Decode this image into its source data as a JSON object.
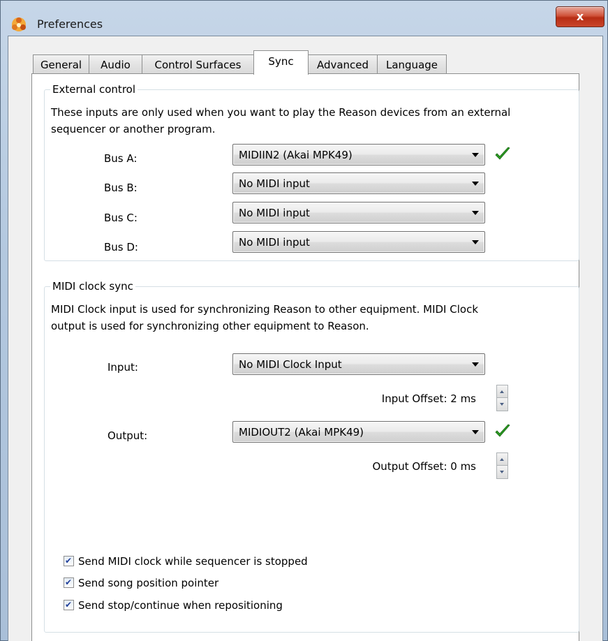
{
  "window": {
    "title": "Preferences",
    "close_label": "x"
  },
  "tabs": [
    {
      "label": "General"
    },
    {
      "label": "Audio"
    },
    {
      "label": "Control Surfaces"
    },
    {
      "label": "Sync"
    },
    {
      "label": "Advanced"
    },
    {
      "label": "Language"
    }
  ],
  "active_tab": "Sync",
  "external_control": {
    "legend": "External control",
    "desc_line1": "These inputs are only used when you want to play the Reason devices from an external",
    "desc_line2": "sequencer or another program.",
    "buses": [
      {
        "label": "Bus A:",
        "value": "MIDIIN2 (Akai MPK49)",
        "connected": true
      },
      {
        "label": "Bus B:",
        "value": "No MIDI input",
        "connected": false
      },
      {
        "label": "Bus C:",
        "value": "No MIDI input",
        "connected": false
      },
      {
        "label": "Bus D:",
        "value": "No MIDI input",
        "connected": false
      }
    ]
  },
  "midi_clock": {
    "legend": "MIDI clock sync",
    "desc_line1": "MIDI Clock input is used for synchronizing Reason to other equipment. MIDI Clock",
    "desc_line2": "output is used for synchronizing other equipment to Reason.",
    "input_label": "Input:",
    "input_value": "No MIDI Clock Input",
    "input_offset_label": "Input Offset: 2 ms",
    "output_label": "Output:",
    "output_value": "MIDIOUT2 (Akai MPK49)",
    "output_connected": true,
    "output_offset_label": "Output Offset: 0 ms",
    "options": [
      {
        "label": "Send MIDI clock while sequencer is stopped",
        "checked": true
      },
      {
        "label": "Send song position pointer",
        "checked": true
      },
      {
        "label": "Send stop/continue when repositioning",
        "checked": true
      }
    ]
  },
  "colors": {
    "check_green": "#2a9a22",
    "close_red": "#c9452a"
  }
}
